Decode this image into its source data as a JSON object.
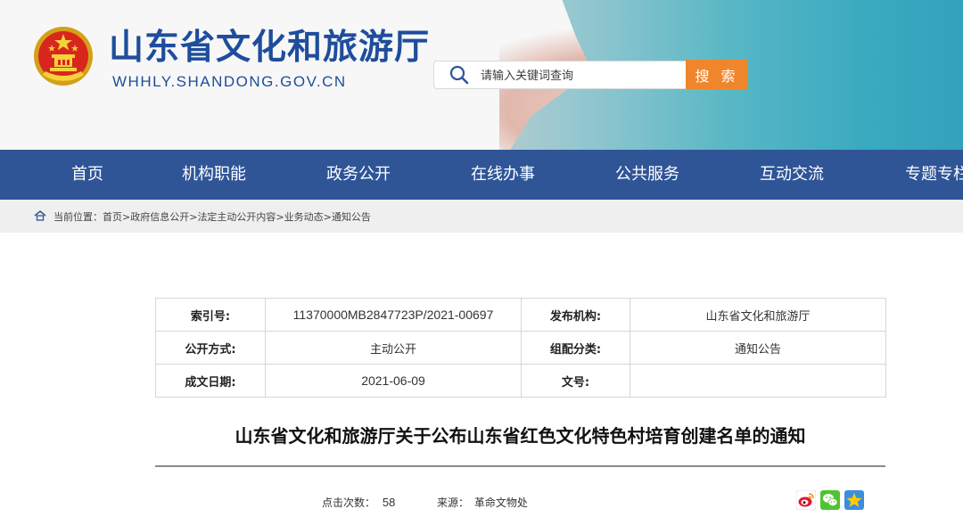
{
  "header": {
    "site_title": "山东省文化和旅游厅",
    "domain": "WHHLY.SHANDONG.GOV.CN",
    "emblem_icon": "national-emblem-icon",
    "search": {
      "placeholder": "请输入关键词查询",
      "button_label": "搜 索",
      "icon": "search-icon"
    }
  },
  "nav": {
    "items": [
      {
        "label": "首页"
      },
      {
        "label": "机构职能"
      },
      {
        "label": "政务公开"
      },
      {
        "label": "在线办事"
      },
      {
        "label": "公共服务"
      },
      {
        "label": "互动交流"
      },
      {
        "label": "专题专栏"
      }
    ]
  },
  "breadcrumb": {
    "prefix": "当前位置：",
    "items": [
      "首页",
      "政府信息公开",
      "法定主动公开内容",
      "业务动态",
      "通知公告"
    ],
    "separator": ">"
  },
  "info": {
    "rows": [
      {
        "l1": "索引号:",
        "v1": "11370000MB2847723P/2021-00697",
        "l2": "发布机构:",
        "v2": "山东省文化和旅游厅"
      },
      {
        "l1": "公开方式:",
        "v1": "主动公开",
        "l2": "组配分类:",
        "v2": "通知公告"
      },
      {
        "l1": "成文日期:",
        "v1": "2021-06-09",
        "l2": "文号:",
        "v2": ""
      }
    ]
  },
  "article": {
    "title": "山东省文化和旅游厅关于公布山东省红色文化特色村培育创建名单的通知",
    "views_label": "点击次数：",
    "views": "58",
    "source_label": "来源：",
    "source": "革命文物处"
  },
  "share": {
    "icons": [
      "weibo-icon",
      "wechat-icon",
      "qzone-icon"
    ]
  },
  "colors": {
    "brand_blue": "#1e4d9c",
    "nav_bg": "#2f5597",
    "search_button": "#f0862c"
  }
}
